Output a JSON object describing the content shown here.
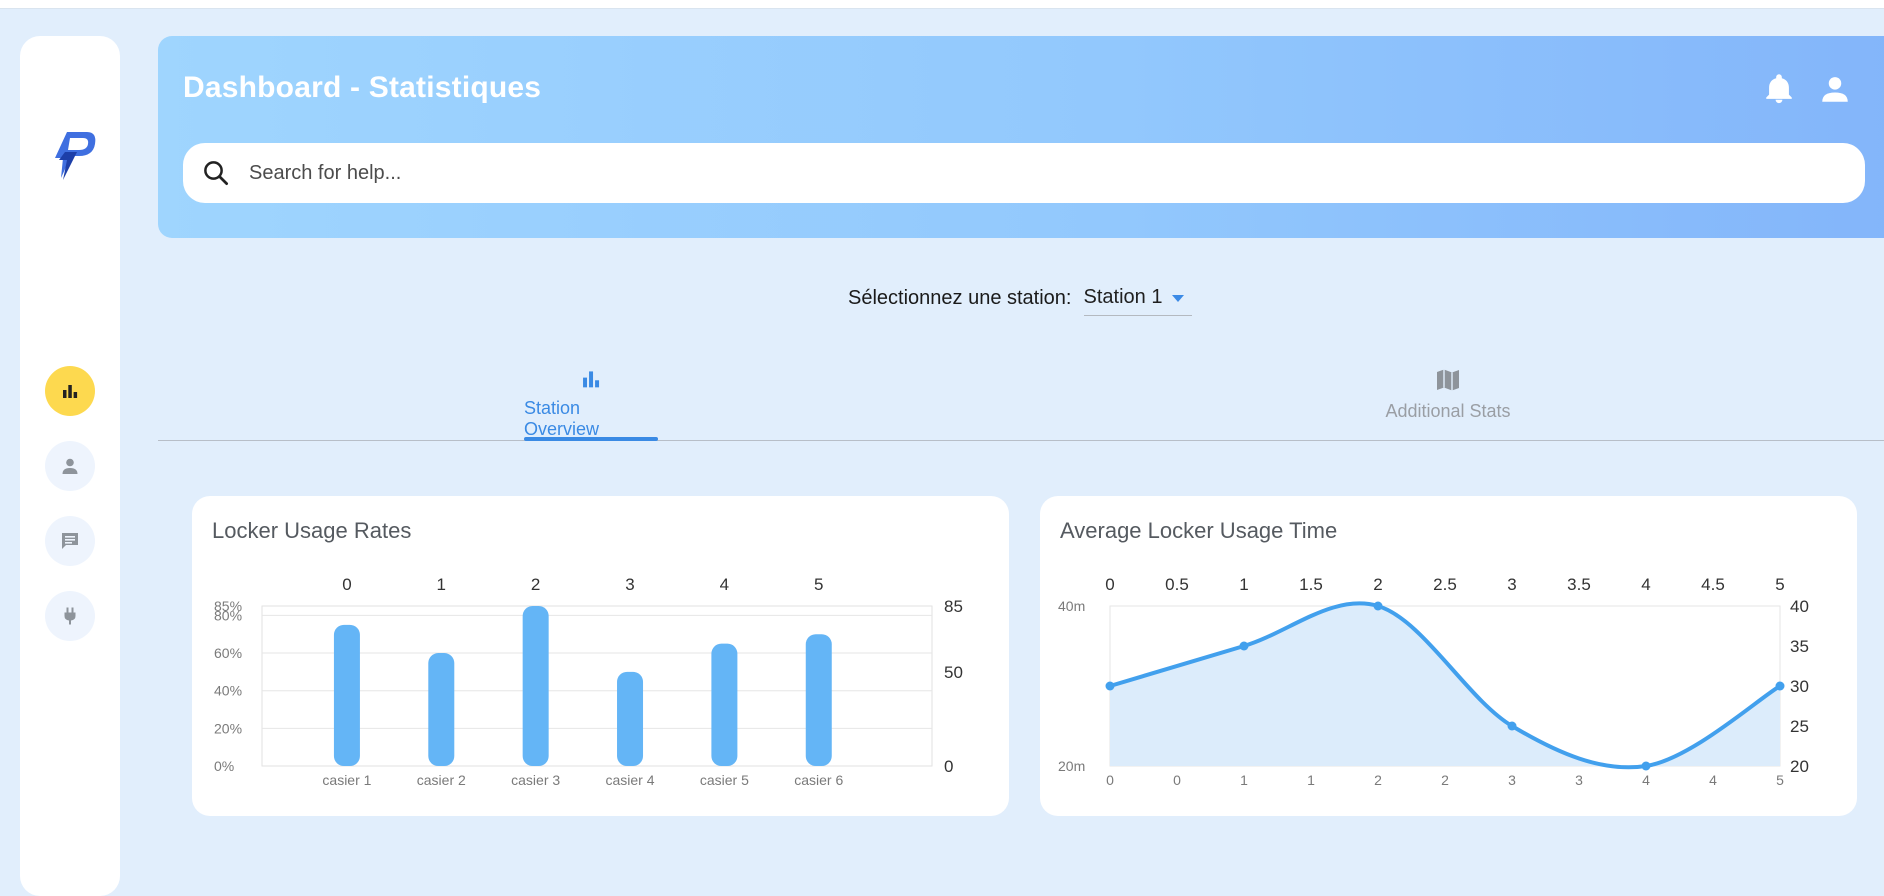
{
  "header": {
    "title": "Dashboard - Statistiques"
  },
  "search": {
    "placeholder": "Search for help..."
  },
  "station": {
    "label": "Sélectionnez une station:",
    "selected": "Station 1"
  },
  "tabs": [
    {
      "label": "Station Overview",
      "icon": "bar-chart-icon",
      "active": true
    },
    {
      "label": "Additional Stats",
      "icon": "map-icon",
      "active": false
    }
  ],
  "sidebar": {
    "items": [
      {
        "icon": "bar-chart-icon",
        "active": true
      },
      {
        "icon": "person-icon",
        "active": false
      },
      {
        "icon": "message-icon",
        "active": false
      },
      {
        "icon": "plug-icon",
        "active": false
      }
    ]
  },
  "colors": {
    "accent": "#3a8ae4",
    "bar": "#64b5f6",
    "line": "#42a0ed",
    "area": "#dcecfb",
    "active_nav": "#fdd94f"
  },
  "chart_data": [
    {
      "type": "bar",
      "title": "Locker Usage Rates",
      "categories": [
        "casier 1",
        "casier 2",
        "casier 3",
        "casier 4",
        "casier 5",
        "casier 6"
      ],
      "top_ticks": [
        "0",
        "1",
        "2",
        "3",
        "4",
        "5"
      ],
      "series": [
        {
          "values": [
            75,
            60,
            85,
            50,
            65,
            70
          ]
        }
      ],
      "y_left_ticks": [
        "0%",
        "20%",
        "40%",
        "60%",
        "80%",
        "85%"
      ],
      "y_right_ticks": [
        "0",
        "50",
        "85"
      ],
      "ylim": [
        0,
        85
      ],
      "grid": true
    },
    {
      "type": "area",
      "title": "Average Locker Usage Time",
      "x": [
        0,
        1,
        2,
        3,
        4,
        5
      ],
      "series": [
        {
          "values": [
            30,
            35,
            40,
            25,
            20,
            30
          ]
        }
      ],
      "top_ticks": [
        "0",
        "0.5",
        "1",
        "1.5",
        "2",
        "2.5",
        "3",
        "3.5",
        "4",
        "4.5",
        "5"
      ],
      "bottom_ticks": [
        "0",
        "0",
        "1",
        "1",
        "2",
        "2",
        "3",
        "3",
        "4",
        "4",
        "5"
      ],
      "y_left_ticks": [
        "20m",
        "40m"
      ],
      "y_right_ticks": [
        "20",
        "25",
        "30",
        "35",
        "40"
      ],
      "ylim": [
        20,
        40
      ],
      "xlim": [
        0,
        5
      ],
      "grid": false
    }
  ]
}
